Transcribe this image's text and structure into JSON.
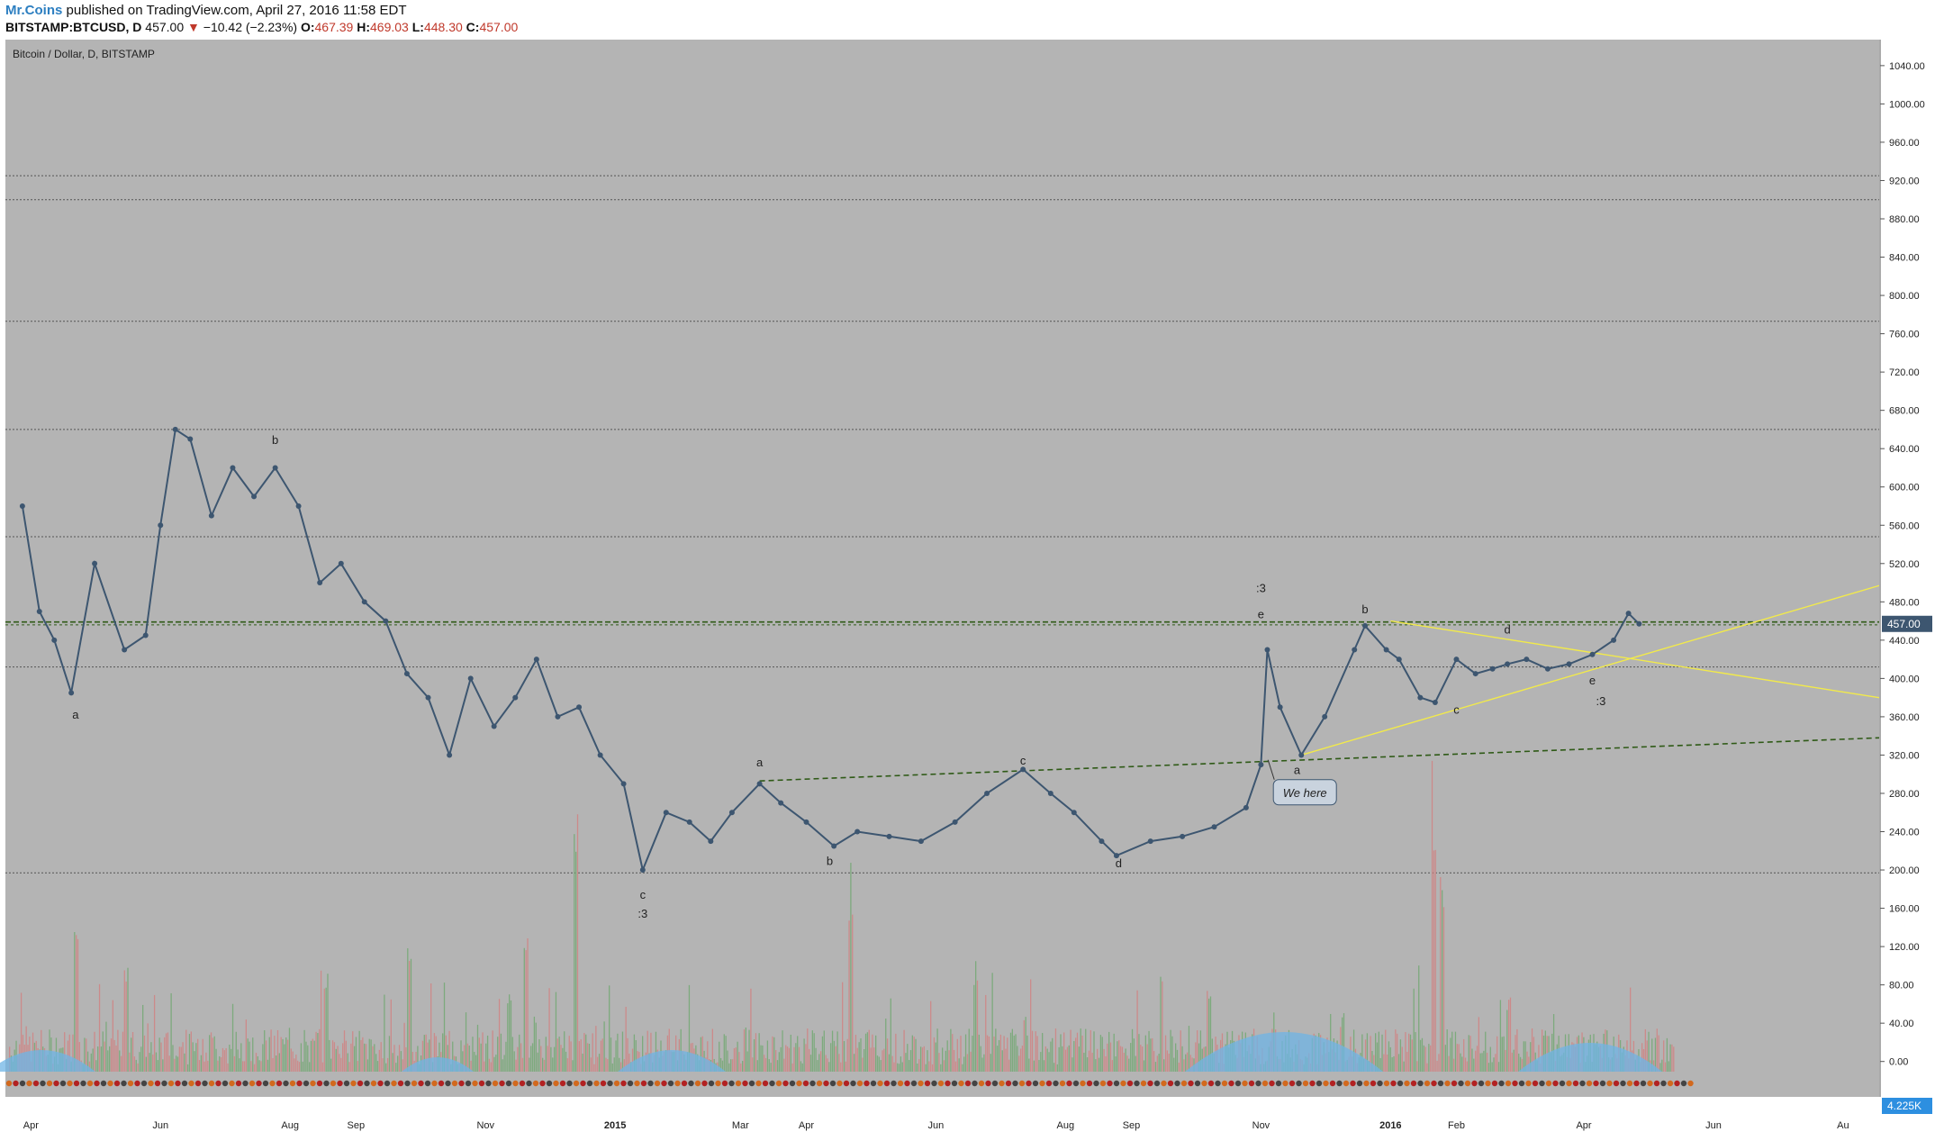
{
  "header": {
    "author": "Mr.Coins",
    "published": " published on TradingView.com, April 27, 2016 11:58 EDT",
    "symbol": "BITSTAMP:BTCUSD, D",
    "price": "457.00",
    "change": "−10.42 (−2.23%)",
    "o_label": "O:",
    "o_value": "467.39",
    "h_label": "H:",
    "h_value": "469.03",
    "l_label": "L:",
    "l_value": "448.30",
    "c_label": "C:",
    "c_value": "457.00"
  },
  "colors": {
    "plot_bg": "#b4b4b4",
    "line": "#3d5670",
    "yellow": "#f2ea4a",
    "green_dashed": "#2f5a17",
    "price_tag": "#3d5670",
    "volume_up": "#7daa7d",
    "volume_down": "#cc8a8a",
    "volume_ma": "#6fb4e6"
  },
  "chart_data": {
    "type": "line",
    "title": "Bitcoin / Dollar, D, BITSTAMP",
    "xlabel": "",
    "ylabel": "",
    "ylim": [
      -30,
      1050
    ],
    "x_ticks": [
      "Apr",
      "Jun",
      "Aug",
      "Sep",
      "Nov",
      "2015",
      "Mar",
      "Apr",
      "Jun",
      "Aug",
      "Sep",
      "Nov",
      "2016",
      "Feb",
      "Apr",
      "Jun",
      "Au"
    ],
    "y_ticks": [
      "1040.00",
      "1000.00",
      "960.00",
      "920.00",
      "880.00",
      "840.00",
      "800.00",
      "760.00",
      "720.00",
      "680.00",
      "640.00",
      "600.00",
      "560.00",
      "520.00",
      "480.00",
      "440.00",
      "400.00",
      "360.00",
      "320.00",
      "280.00",
      "240.00",
      "200.00",
      "160.00",
      "120.00",
      "80.00",
      "40.00",
      "0.00"
    ],
    "last_price_label": "457.00",
    "volume_label": "4.225K",
    "series": [
      {
        "x": [
          "2014-03-28",
          "2014-04-05",
          "2014-04-12",
          "2014-04-20",
          "2014-05-01",
          "2014-05-15",
          "2014-05-25",
          "2014-06-01",
          "2014-06-08",
          "2014-06-15",
          "2014-06-25",
          "2014-07-05",
          "2014-07-15",
          "2014-07-25",
          "2014-08-05",
          "2014-08-15",
          "2014-08-25",
          "2014-09-05",
          "2014-09-15",
          "2014-09-25",
          "2014-10-05",
          "2014-10-15",
          "2014-10-25",
          "2014-11-05",
          "2014-11-15",
          "2014-11-25",
          "2014-12-05",
          "2014-12-15",
          "2014-12-25",
          "2015-01-05",
          "2015-01-14",
          "2015-01-25",
          "2015-02-05",
          "2015-02-15",
          "2015-02-25",
          "2015-03-10",
          "2015-03-20",
          "2015-04-01",
          "2015-04-14",
          "2015-04-25",
          "2015-05-10",
          "2015-05-25",
          "2015-06-10",
          "2015-06-25",
          "2015-07-12",
          "2015-07-25",
          "2015-08-05",
          "2015-08-18",
          "2015-08-25",
          "2015-09-10",
          "2015-09-25",
          "2015-10-10",
          "2015-10-25",
          "2015-11-01",
          "2015-11-04",
          "2015-11-10",
          "2015-11-20",
          "2015-12-01",
          "2015-12-15",
          "2015-12-20",
          "2015-12-30",
          "2016-01-05",
          "2016-01-15",
          "2016-01-22",
          "2016-02-01",
          "2016-02-10",
          "2016-02-18",
          "2016-02-25",
          "2016-03-05",
          "2016-03-15",
          "2016-03-25",
          "2016-04-05",
          "2016-04-15",
          "2016-04-22",
          "2016-04-27"
        ],
        "y": [
          580,
          470,
          440,
          385,
          520,
          430,
          445,
          560,
          660,
          650,
          570,
          620,
          590,
          620,
          580,
          500,
          520,
          480,
          460,
          405,
          380,
          320,
          400,
          350,
          380,
          420,
          360,
          370,
          320,
          290,
          200,
          260,
          250,
          230,
          260,
          290,
          270,
          250,
          225,
          240,
          235,
          230,
          250,
          280,
          305,
          280,
          260,
          230,
          215,
          230,
          235,
          245,
          265,
          310,
          430,
          370,
          320,
          360,
          430,
          455,
          430,
          420,
          380,
          375,
          420,
          405,
          410,
          415,
          420,
          410,
          415,
          425,
          440,
          468,
          457
        ]
      }
    ],
    "annotations": {
      "wave_labels": [
        "a",
        "b",
        "c",
        ":3",
        "a",
        "b",
        "c",
        "d",
        ":3",
        "e",
        "a",
        "b",
        "c",
        "d",
        "e",
        ":3"
      ],
      "callout": "We here"
    }
  }
}
